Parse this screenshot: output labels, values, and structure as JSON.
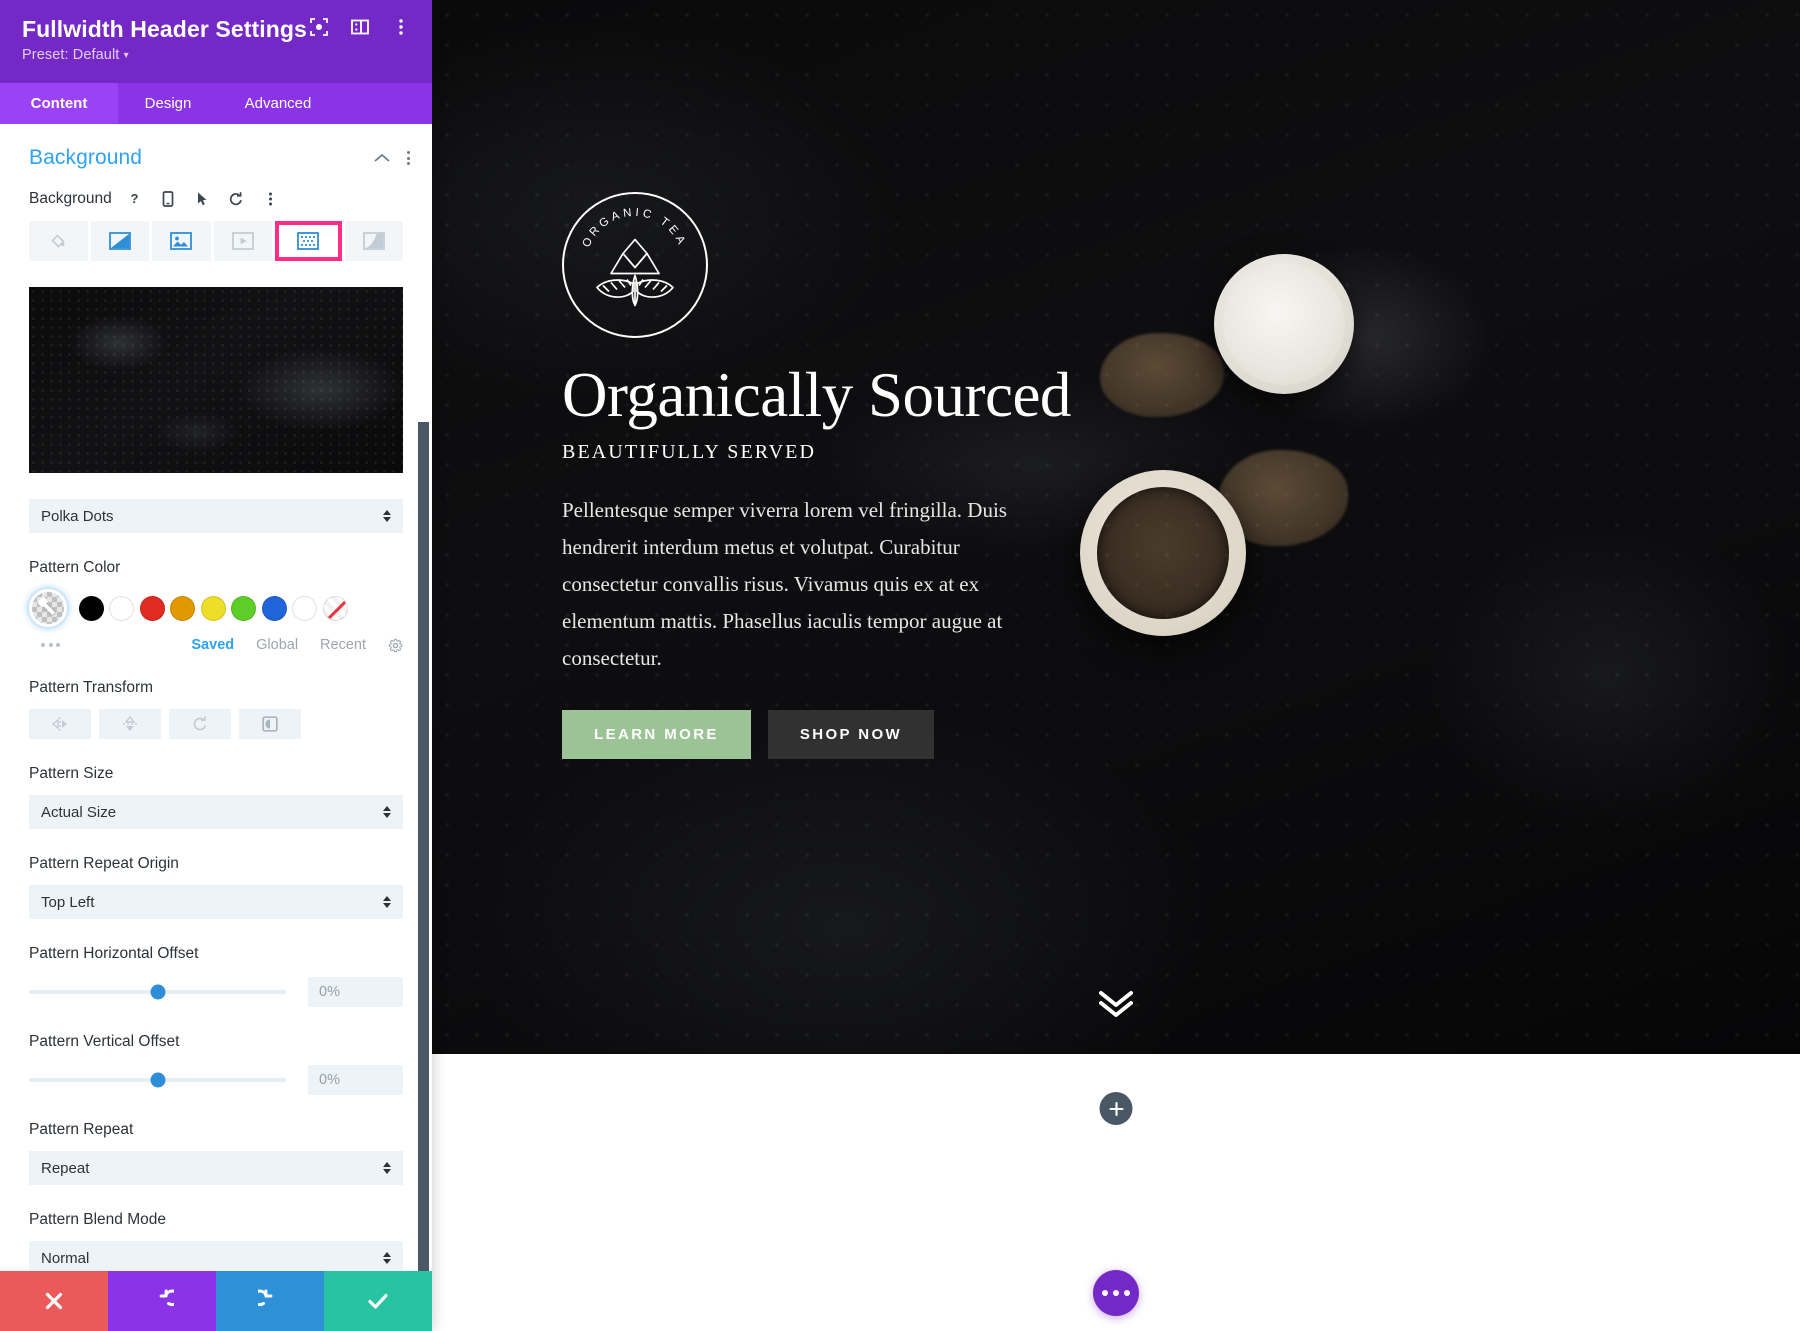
{
  "modal": {
    "title": "Fullwidth Header Settings",
    "preset_label": "Preset: Default",
    "preset_caret": "▾",
    "header_icons": [
      {
        "name": "focus-icon"
      },
      {
        "name": "layout-toggle-icon"
      },
      {
        "name": "more-options-icon"
      }
    ],
    "tabs": [
      {
        "label": "Content",
        "active": true
      },
      {
        "label": "Design",
        "active": false
      },
      {
        "label": "Advanced",
        "active": false
      }
    ]
  },
  "background_section": {
    "title": "Background",
    "collapse_icon": "chevron-up-icon",
    "options_icon": "more-options-icon",
    "field_label": "Background",
    "field_icons": [
      "help-icon",
      "responsive-icon",
      "hover-icon",
      "reset-icon",
      "more-icon"
    ],
    "bg_types": [
      {
        "name": "background-color-tab",
        "selected": false
      },
      {
        "name": "background-gradient-tab",
        "selected": false
      },
      {
        "name": "background-image-tab",
        "selected": false
      },
      {
        "name": "background-video-tab",
        "selected": false
      },
      {
        "name": "background-pattern-tab",
        "selected": true
      },
      {
        "name": "background-mask-tab",
        "selected": false
      }
    ],
    "pattern_style": {
      "label": "",
      "value": "Polka Dots"
    },
    "pattern_color": {
      "label": "Pattern Color",
      "swatches": [
        "#000000",
        "#ffffff",
        "#e02b20",
        "#e09900",
        "#edde28",
        "#5dce28",
        "#1f64d8",
        "#ffffff"
      ],
      "picker_name": "color-picker-eyedropper",
      "none_name": "no-color-swatch",
      "tabs": [
        {
          "label": "Saved",
          "active": true
        },
        {
          "label": "Global",
          "active": false
        },
        {
          "label": "Recent",
          "active": false
        }
      ],
      "settings_icon": "gear-icon"
    },
    "pattern_transform": {
      "label": "Pattern Transform",
      "buttons": [
        {
          "name": "flip-horizontal-button"
        },
        {
          "name": "flip-vertical-button"
        },
        {
          "name": "rotate-button"
        },
        {
          "name": "invert-button"
        }
      ]
    },
    "pattern_size": {
      "label": "Pattern Size",
      "value": "Actual Size"
    },
    "pattern_repeat_origin": {
      "label": "Pattern Repeat Origin",
      "value": "Top Left"
    },
    "pattern_horizontal_offset": {
      "label": "Pattern Horizontal Offset",
      "value": "0%"
    },
    "pattern_vertical_offset": {
      "label": "Pattern Vertical Offset",
      "value": "0%"
    },
    "pattern_repeat": {
      "label": "Pattern Repeat",
      "value": "Repeat"
    },
    "pattern_blend_mode": {
      "label": "Pattern Blend Mode",
      "value": "Normal"
    }
  },
  "action_bar": [
    {
      "name": "cancel-button",
      "icon": "close-icon",
      "color": "#eb5a5a"
    },
    {
      "name": "undo-button",
      "icon": "undo-icon",
      "color": "#8b33e6"
    },
    {
      "name": "redo-button",
      "icon": "redo-icon",
      "color": "#2e91d8"
    },
    {
      "name": "save-button",
      "icon": "check-icon",
      "color": "#28c3a0"
    }
  ],
  "hero": {
    "logo_text": "ORGANIC TEA",
    "heading": "Organically Sourced",
    "subheading": "BEAUTIFULLY SERVED",
    "paragraph": "Pellentesque semper viverra lorem vel fringilla. Duis hendrerit interdum metus et volutpat. Curabitur consectetur convallis risus. Vivamus quis ex at ex elementum mattis. Phasellus iaculis tempor augue at consectetur.",
    "primary_button": "LEARN MORE",
    "secondary_button": "SHOP NOW",
    "primary_button_color": "#9cc395",
    "secondary_button_color": "#313131",
    "scroll_icon": "double-chevron-down-icon"
  },
  "builder": {
    "add_row_icon": "plus-icon",
    "fab_icon": "ellipsis-icon",
    "fab_color": "#7429c6"
  }
}
